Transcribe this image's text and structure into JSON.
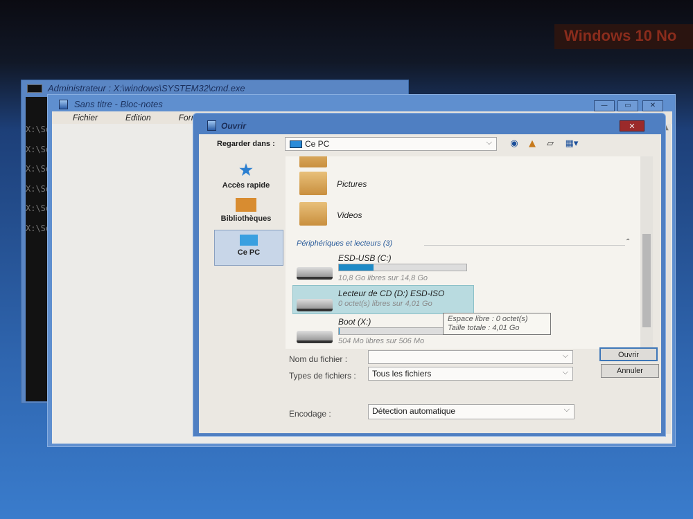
{
  "banner": "Windows 10 No",
  "cmd": {
    "title": "Administrateur : X:\\windows\\SYSTEM32\\cmd.exe",
    "lines": [
      "X:\\So",
      "X:\\So",
      "X:\\So",
      "X:\\So",
      "X:\\So",
      "X:\\So"
    ]
  },
  "notepad": {
    "title": "Sans titre - Bloc-notes",
    "menu": [
      "Fichier",
      "Edition",
      "Format"
    ],
    "minimize": "—",
    "maximize": "▭",
    "close": "✕"
  },
  "dialog": {
    "title": "Ouvrir",
    "close": "✕",
    "look_in_label": "Regarder dans :",
    "look_in_value": "Ce PC",
    "places": [
      {
        "label": "Accès rapide",
        "icon": "star-icon"
      },
      {
        "label": "Bibliothèques",
        "icon": "libraries-icon"
      },
      {
        "label": "Ce PC",
        "icon": "computer-icon",
        "selected": true
      }
    ],
    "folders": [
      {
        "name": "Pictures"
      },
      {
        "name": "Videos"
      }
    ],
    "group": "Périphériques et lecteurs (3)",
    "drives": [
      {
        "name": "ESD-USB (C:)",
        "free": "10,8 Go libres sur 14,8 Go",
        "used_percent": 27
      },
      {
        "name": "Lecteur de CD (D:) ESD-ISO",
        "free": "0 octet(s) libres sur 4,01 Go",
        "selected": true
      },
      {
        "name": "Boot (X:)",
        "free": "504 Mo libres sur 506 Mo",
        "used_percent": 0.4
      }
    ],
    "tooltip": [
      "Espace libre : 0 octet(s)",
      "Taille totale : 4,01 Go"
    ],
    "filename_label": "Nom du fichier :",
    "filename_value": "",
    "filetype_label": "Types de fichiers :",
    "filetype_value": "Tous les fichiers",
    "encoding_label": "Encodage :",
    "encoding_value": "Détection automatique",
    "open_button": "Ouvrir",
    "cancel_button": "Annuler"
  }
}
